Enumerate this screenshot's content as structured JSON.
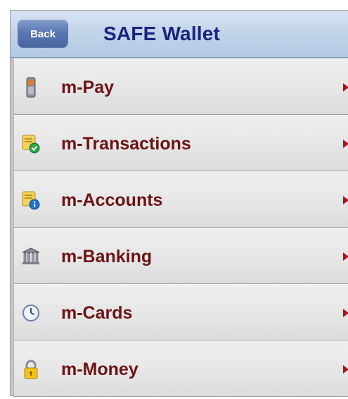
{
  "nav": {
    "back_label": "Back",
    "title": "SAFE Wallet"
  },
  "menu": {
    "items": [
      {
        "label": "m-Pay",
        "icon": "mobile-phone-icon"
      },
      {
        "label": "m-Transactions",
        "icon": "document-check-icon"
      },
      {
        "label": "m-Accounts",
        "icon": "document-info-icon"
      },
      {
        "label": "m-Banking",
        "icon": "bank-building-icon"
      },
      {
        "label": "m-Cards",
        "icon": "clock-card-icon"
      },
      {
        "label": "m-Money",
        "icon": "padlock-icon"
      }
    ]
  },
  "colors": {
    "title": "#1a2380",
    "item_label": "#6b1414",
    "chevron": "#a31818",
    "back_button": "#5674ad"
  }
}
